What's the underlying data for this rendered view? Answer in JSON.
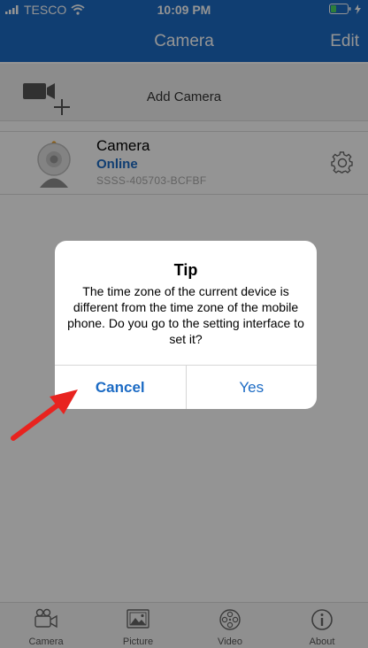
{
  "status_bar": {
    "carrier": "TESCO",
    "time": "10:09 PM"
  },
  "navbar": {
    "title": "Camera",
    "edit_label": "Edit"
  },
  "add_camera": {
    "label": "Add Camera"
  },
  "camera_item": {
    "name": "Camera",
    "status": "Online",
    "uid": "SSSS-405703-BCFBF"
  },
  "dialog": {
    "title": "Tip",
    "message": "The time zone of the current device is different from the time zone of the mobile phone. Do you go to the setting interface to set it?",
    "cancel_label": "Cancel",
    "yes_label": "Yes"
  },
  "tabs": [
    {
      "label": "Camera",
      "icon": "camera-icon"
    },
    {
      "label": "Picture",
      "icon": "picture-icon"
    },
    {
      "label": "Video",
      "icon": "video-reel-icon"
    },
    {
      "label": "About",
      "icon": "info-icon"
    }
  ],
  "colors": {
    "accent": "#1c6bc4",
    "arrow": "#e8231f"
  }
}
